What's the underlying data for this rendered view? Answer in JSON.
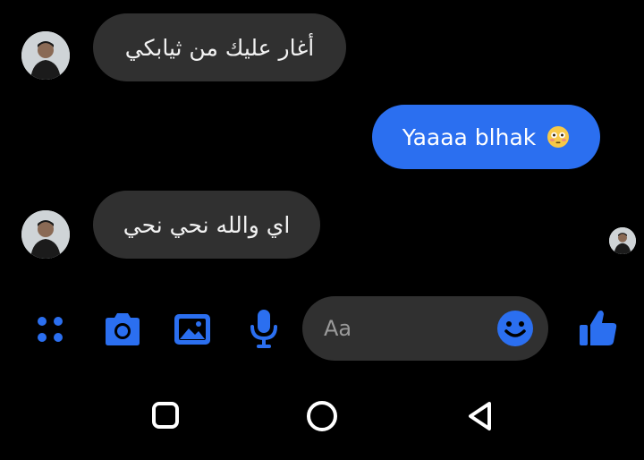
{
  "messages": [
    {
      "direction": "incoming",
      "text": "أغار عليك من ثيابكي"
    },
    {
      "direction": "outgoing",
      "text": "Yaaaa blhak",
      "emoji": "😳"
    },
    {
      "direction": "incoming",
      "text": "اي والله نحي نحي"
    }
  ],
  "composer": {
    "placeholder": "Aa",
    "icons": [
      "apps-icon",
      "camera-icon",
      "gallery-icon",
      "microphone-icon",
      "emoji-icon",
      "thumbs-up-icon"
    ]
  },
  "navbar": {
    "icons": [
      "recents-icon",
      "home-icon",
      "back-icon"
    ]
  },
  "colors": {
    "accent": "#2b6ff0",
    "incoming_bubble": "#303030",
    "background": "#000000",
    "navbar_icon": "#ffffff"
  }
}
